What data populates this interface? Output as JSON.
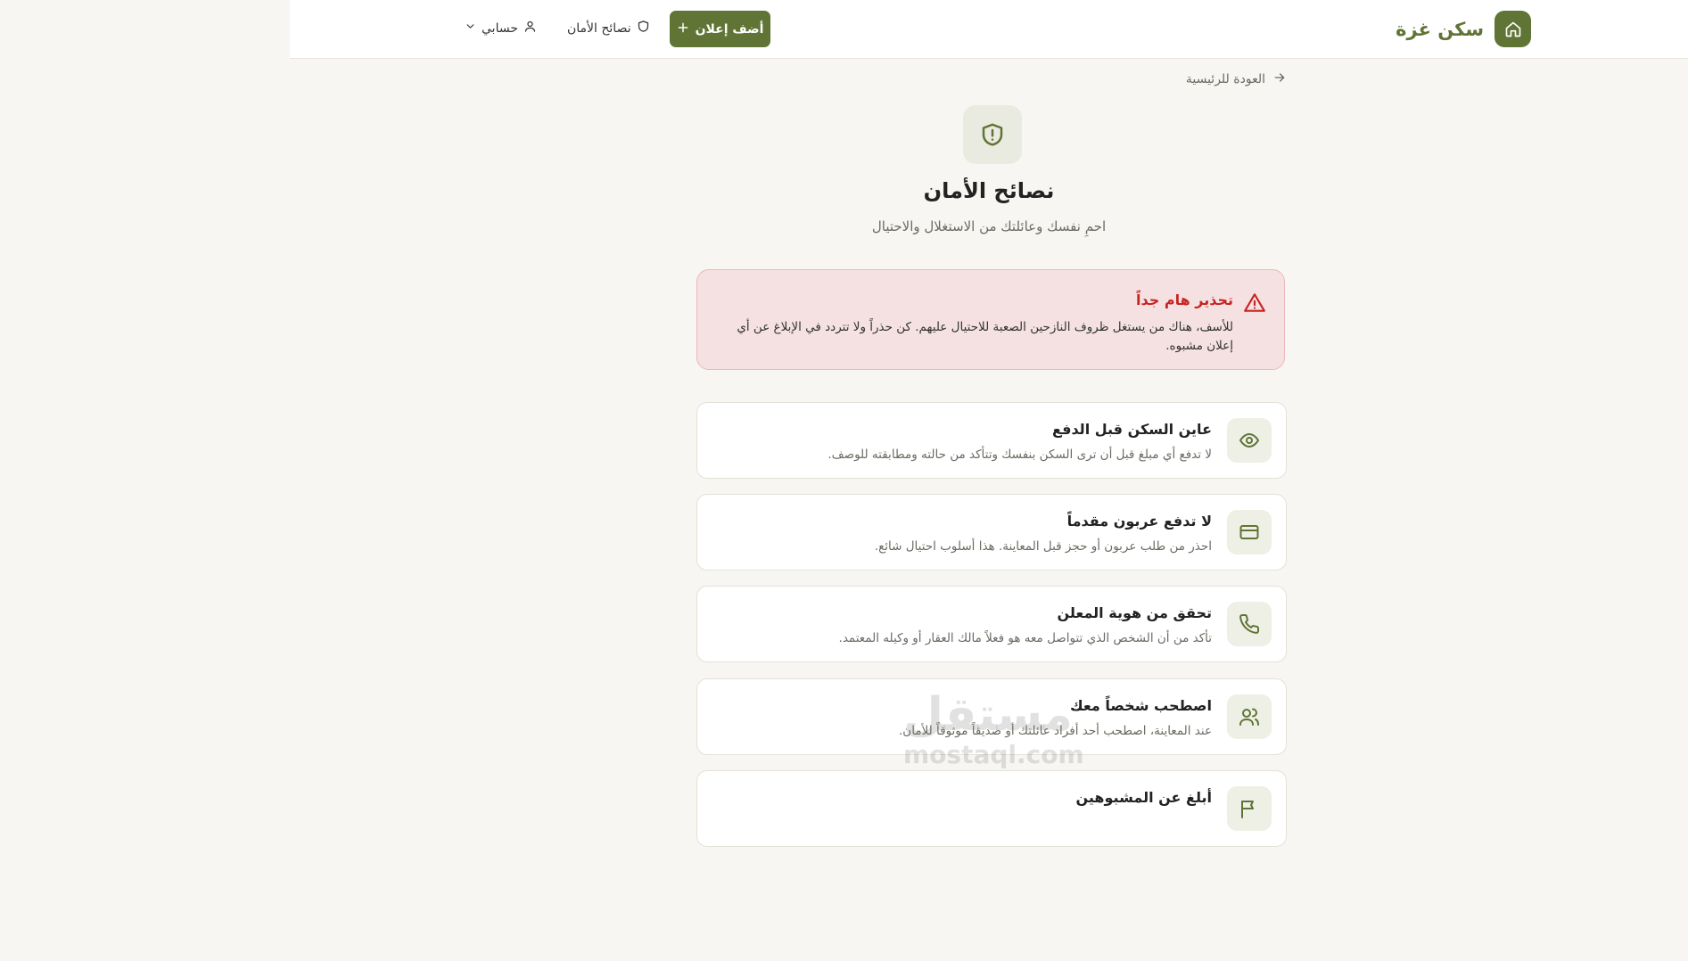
{
  "header": {
    "brand_name": "سكن غزة",
    "add_listing_label": "أضف إعلان",
    "safety_tips_label": "نصائح الأمان",
    "account_label": "حسابي"
  },
  "main": {
    "back_label": "العودة للرئيسية",
    "title": "نصائح الأمان",
    "subtitle": "احمِ نفسك وعائلتك من الاستغلال والاحتيال",
    "warning": {
      "title": "تحذير هام جداً",
      "text": "للأسف، هناك من يستغل ظروف النازحين الصعبة للاحتيال عليهم. كن حذراً ولا تتردد في الإبلاغ عن أي إعلان مشبوه."
    },
    "tips": [
      {
        "icon": "eye-icon",
        "title": "عاين السكن قبل الدفع",
        "desc": "لا تدفع أي مبلغ قبل أن ترى السكن بنفسك وتتأكد من حالته ومطابقته للوصف."
      },
      {
        "icon": "credit-card-icon",
        "title": "لا تدفع عربون مقدماً",
        "desc": "احذر من طلب عربون أو حجز قبل المعاينة. هذا أسلوب احتيال شائع."
      },
      {
        "icon": "phone-icon",
        "title": "تحقق من هوية المعلن",
        "desc": "تأكد من أن الشخص الذي تتواصل معه هو فعلاً مالك العقار أو وكيله المعتمد."
      },
      {
        "icon": "users-icon",
        "title": "اصطحب شخصاً معك",
        "desc": "عند المعاينة، اصطحب أحد أفراد عائلتك أو صديقاً موثوقاً للأمان."
      },
      {
        "icon": "flag-icon",
        "title": "أبلغ عن المشبوهين",
        "desc": ""
      }
    ]
  },
  "watermark": {
    "arabic": "مستقل",
    "latin": "mostaql.com"
  },
  "colors": {
    "brand": "#5f7435",
    "warning_bg": "#f5e1e1",
    "warning_text": "#c72424",
    "page_bg": "#f7f6f3"
  }
}
